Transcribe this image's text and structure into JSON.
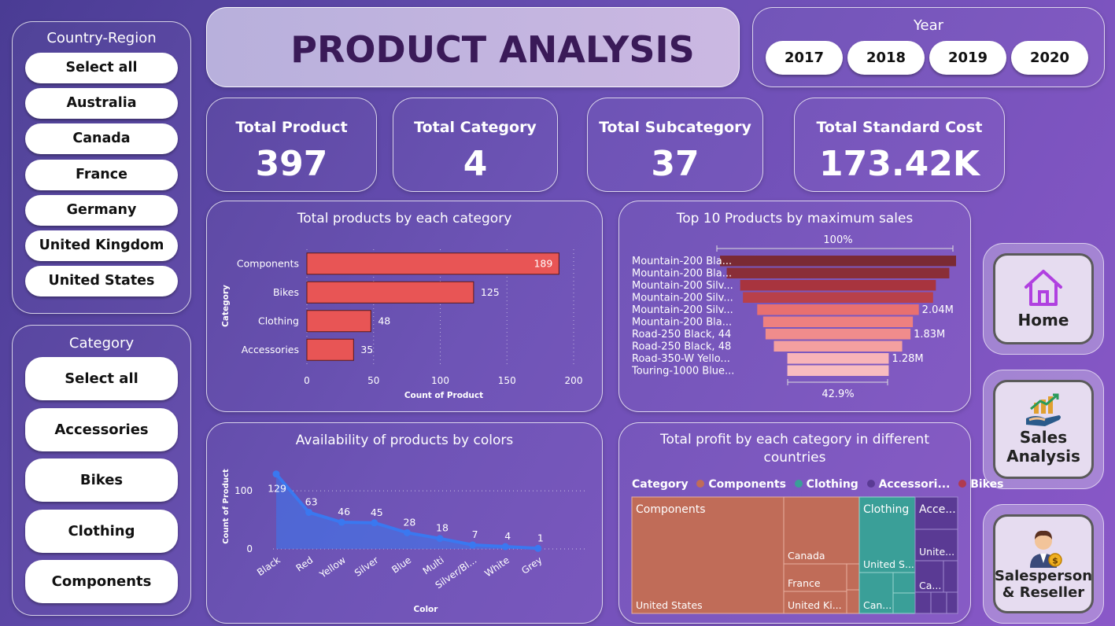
{
  "header": {
    "title": "PRODUCT ANALYSIS"
  },
  "year_slicer": {
    "title": "Year",
    "options": [
      "2017",
      "2018",
      "2019",
      "2020"
    ]
  },
  "country_slicer": {
    "title": "Country-Region",
    "options": [
      "Select all",
      "Australia",
      "Canada",
      "France",
      "Germany",
      "United Kingdom",
      "United States"
    ]
  },
  "category_slicer": {
    "title": "Category",
    "options": [
      "Select all",
      "Accessories",
      "Bikes",
      "Clothing",
      "Components"
    ]
  },
  "kpis": [
    {
      "label": "Total Product",
      "value": "397"
    },
    {
      "label": "Total Category",
      "value": "4"
    },
    {
      "label": "Total Subcategory",
      "value": "37"
    },
    {
      "label": "Total Standard Cost",
      "value": "173.42K"
    }
  ],
  "nav": {
    "home": "Home",
    "sales_1": "Sales",
    "sales_2": "Analysis",
    "sp_1": "Salesperson",
    "sp_2": "& Reseller"
  },
  "colors": {
    "bar": "#e85555",
    "line": "#3a78f0",
    "components": "#c06c58",
    "clothing": "#3a9f98",
    "accessories": "#5a3a94",
    "bikes": "#b03a50"
  },
  "chart_data": [
    {
      "type": "bar",
      "title": "Total products by each category",
      "categories": [
        "Components",
        "Bikes",
        "Clothing",
        "Accessories"
      ],
      "values": [
        189,
        125,
        48,
        35
      ],
      "xlabel": "Count of Product",
      "ylabel": "Category",
      "xlim": [
        0,
        200
      ],
      "xticks": [
        "0",
        "50",
        "100",
        "150",
        "200"
      ],
      "grid": true
    },
    {
      "type": "funnel",
      "title": "Top 10 Products by maximum sales",
      "categories": [
        "Mountain-200 Bla...",
        "Mountain-200 Bla...",
        "Mountain-200 Silv...",
        "Mountain-200 Silv...",
        "Mountain-200 Silv...",
        "Mountain-200 Bla...",
        "Road-250 Black, 44",
        "Road-250 Black, 48",
        "Road-350-W Yello...",
        "Touring-1000 Blue..."
      ],
      "values": [
        2.98,
        2.81,
        2.47,
        2.4,
        2.04,
        1.89,
        1.83,
        1.62,
        1.28,
        1.28
      ],
      "data_labels": [
        "",
        "",
        "",
        "",
        "2.04M",
        "",
        "1.83M",
        "",
        "1.28M",
        ""
      ],
      "top_label": "100%",
      "bottom_label": "42.9%"
    },
    {
      "type": "area",
      "title": "Availability of products by colors",
      "categories": [
        "Black",
        "Red",
        "Yellow",
        "Silver",
        "Blue",
        "Multi",
        "Silver/Bl...",
        "White",
        "Grey"
      ],
      "values": [
        129,
        63,
        46,
        45,
        28,
        18,
        7,
        4,
        1
      ],
      "xlabel": "Color",
      "ylabel": "Count of Product",
      "ylim": [
        0,
        130
      ],
      "yticks": [
        "0",
        "100"
      ]
    },
    {
      "type": "treemap",
      "title": "Total profit by each category in different countries",
      "legend_title": "Category",
      "legend": [
        "Components",
        "Clothing",
        "Accessori...",
        "Bikes"
      ],
      "labels": {
        "components": "Components",
        "united_states": "United States",
        "canada": "Canada",
        "france": "France",
        "united_kingdom": "United Ki...",
        "clothing": "Clothing",
        "clothing_us": "United S...",
        "clothing_can": "Can...",
        "accessories": "Acce...",
        "acc_us": "Unite...",
        "acc_ca": "Ca..."
      }
    }
  ]
}
